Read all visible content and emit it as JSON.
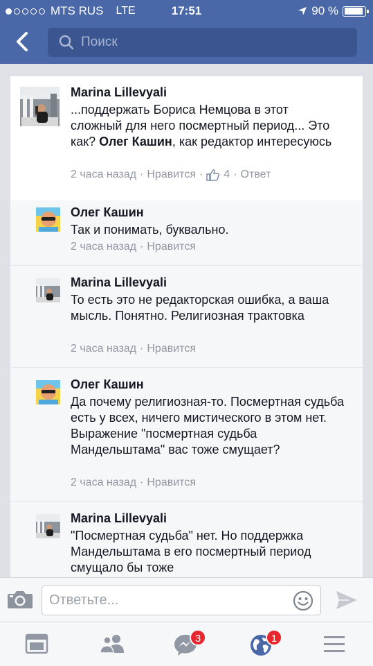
{
  "status_bar": {
    "carrier": "MTS RUS",
    "network": "LTE",
    "time": "17:51",
    "battery": "90 %"
  },
  "search": {
    "placeholder": "Поиск"
  },
  "main_comment": {
    "author": "Marina Lillevyali",
    "text_part1": "...поддержать Бориса Немцова в этот сложный для него посмертный период... Это как? ",
    "text_mention": "Олег Кашин",
    "text_part2": ", как редактор интересуюсь",
    "time": "2 часа назад",
    "like_label": "Нравится",
    "likes_count": "4",
    "reply_label": "Ответ"
  },
  "replies": [
    {
      "author": "Олег Кашин",
      "text": "Так и понимать, буквально.",
      "time": "2 часа назад",
      "like_label": "Нравится"
    },
    {
      "author": "Marina Lillevyali",
      "text": "То есть это не редакторская ошибка, а ваша мысль. Понятно. Религиозная трактовка",
      "time": "2 часа назад",
      "like_label": "Нравится"
    },
    {
      "author": "Олег Кашин",
      "text": "Да почему религиозная-то. Посмертная судьба есть у всех, ничего мистического в этом нет. Выражение \"посмертная судьба Мандельштама\" вас тоже смущает?",
      "time": "2 часа назад",
      "like_label": "Нравится"
    },
    {
      "author": "Marina Lillevyali",
      "text": "\"Посмертная судьба\" нет. Но поддержка Мандельштама в его посмертный период смущало бы тоже",
      "time": "",
      "like_label": ""
    }
  ],
  "composer": {
    "placeholder": "Ответьте..."
  },
  "tabbar": {
    "messages_badge": "3",
    "notifications_badge": "1"
  },
  "colors": {
    "header": "#4a67a8",
    "search_bg": "#3b5591",
    "badge": "#e8262d",
    "meta_text": "#9197a3"
  }
}
